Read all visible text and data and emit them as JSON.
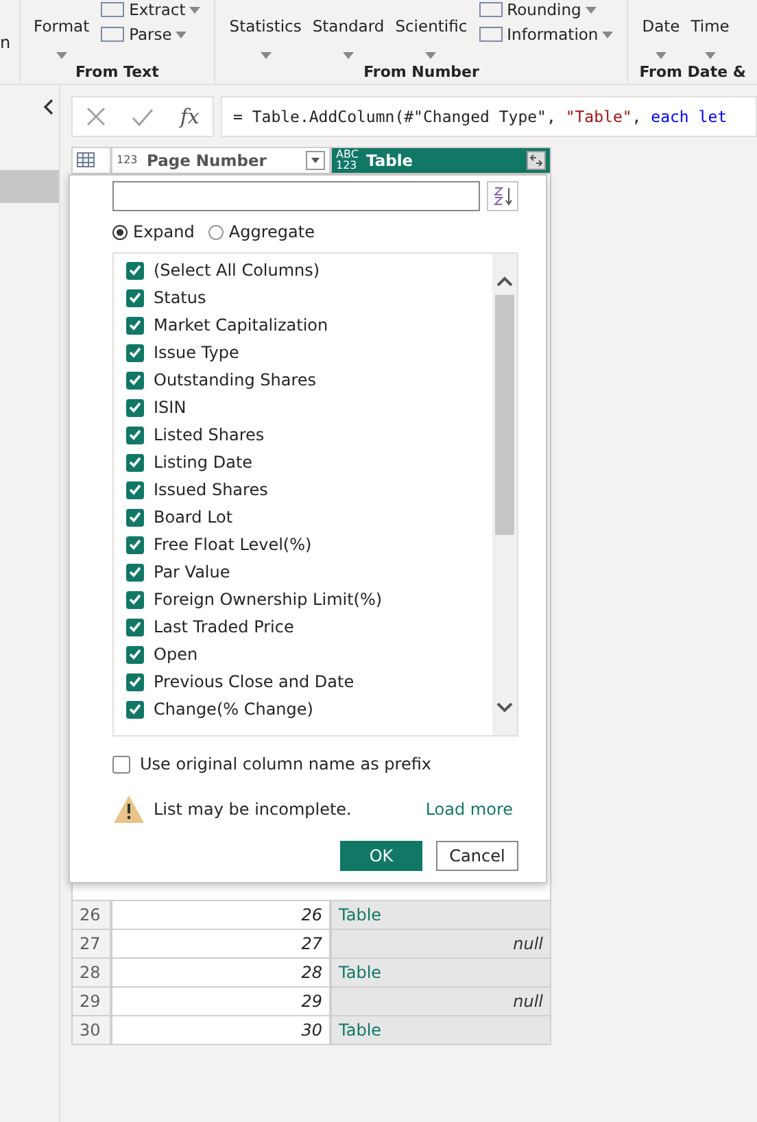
{
  "ribbon": {
    "cut_label": "n",
    "groups": [
      {
        "label": "From Text",
        "items": [
          {
            "kind": "large",
            "label": "Format"
          },
          {
            "kind": "small",
            "label": "Extract"
          },
          {
            "kind": "small",
            "label": "Parse"
          }
        ]
      },
      {
        "label": "From Number",
        "items": [
          {
            "kind": "large",
            "label": "Statistics"
          },
          {
            "kind": "large",
            "label": "Standard"
          },
          {
            "kind": "large",
            "label": "Scientific"
          },
          {
            "kind": "small",
            "label": "Rounding"
          },
          {
            "kind": "small",
            "label": "Information"
          }
        ]
      },
      {
        "label": "From Date &",
        "items": [
          {
            "kind": "large",
            "label": "Date"
          },
          {
            "kind": "large",
            "label": "Time"
          }
        ]
      }
    ]
  },
  "formula": {
    "fx": "fx",
    "parts": [
      {
        "kind": "plain",
        "text": "= Table.AddColumn(#\"Changed Type\", "
      },
      {
        "kind": "string",
        "text": "\"Table\""
      },
      {
        "kind": "plain",
        "text": ", "
      },
      {
        "kind": "keyword",
        "text": "each let"
      }
    ]
  },
  "table": {
    "columns": [
      {
        "type": "123",
        "label": "Page Number",
        "selected": false
      },
      {
        "type": "ABC 123",
        "label": "Table",
        "selected": true
      }
    ],
    "rows": [
      {
        "num": "26",
        "page": "26",
        "value": "Table",
        "kind": "table"
      },
      {
        "num": "27",
        "page": "27",
        "value": "null",
        "kind": "null"
      },
      {
        "num": "28",
        "page": "28",
        "value": "Table",
        "kind": "table"
      },
      {
        "num": "29",
        "page": "29",
        "value": "null",
        "kind": "null"
      },
      {
        "num": "30",
        "page": "30",
        "value": "Table",
        "kind": "table"
      }
    ]
  },
  "dialog": {
    "modes": [
      {
        "label": "Expand",
        "selected": true
      },
      {
        "label": "Aggregate",
        "selected": false
      }
    ],
    "columns": [
      {
        "label": "(Select All Columns)",
        "checked": true
      },
      {
        "label": "Status",
        "checked": true
      },
      {
        "label": "Market Capitalization",
        "checked": true
      },
      {
        "label": "Issue Type",
        "checked": true
      },
      {
        "label": "Outstanding Shares",
        "checked": true
      },
      {
        "label": "ISIN",
        "checked": true
      },
      {
        "label": "Listed Shares",
        "checked": true
      },
      {
        "label": "Listing Date",
        "checked": true
      },
      {
        "label": "Issued Shares",
        "checked": true
      },
      {
        "label": "Board Lot",
        "checked": true
      },
      {
        "label": "Free Float Level(%)",
        "checked": true
      },
      {
        "label": "Par Value",
        "checked": true
      },
      {
        "label": "Foreign Ownership Limit(%)",
        "checked": true
      },
      {
        "label": "Last Traded Price",
        "checked": true
      },
      {
        "label": "Open",
        "checked": true
      },
      {
        "label": "Previous Close and Date",
        "checked": true
      },
      {
        "label": "Change(% Change)",
        "checked": true
      }
    ],
    "prefix": {
      "label": "Use original column name as prefix",
      "checked": false
    },
    "warning": "List may be incomplete.",
    "load_more": "Load more",
    "buttons": [
      {
        "label": "OK",
        "kind": "primary"
      },
      {
        "label": "Cancel",
        "kind": "secondary"
      }
    ]
  }
}
